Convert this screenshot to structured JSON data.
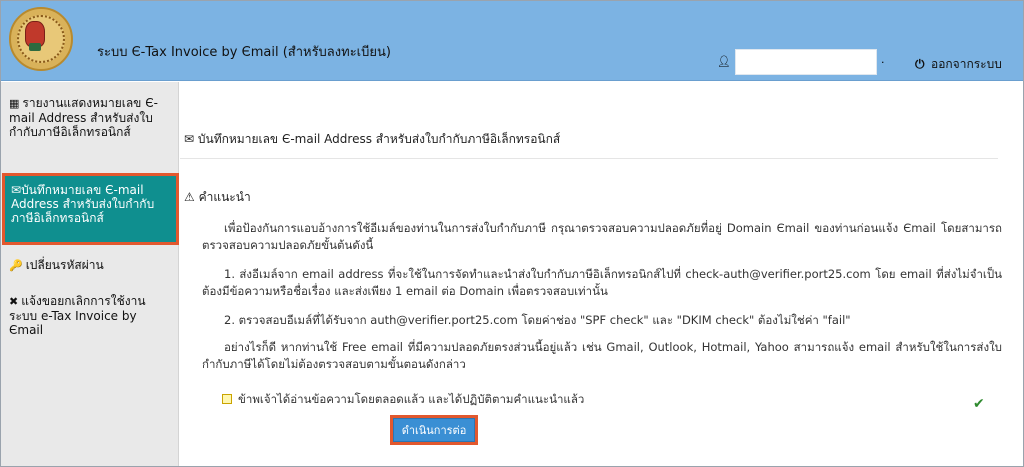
{
  "header": {
    "app_title": "ระบบ Є-Tax Invoice by Єmail (สำหรับลงทะเบียน)",
    "user_icon": "user-icon",
    "user_name": "",
    "logout_label": "ออกจากระบบ"
  },
  "sidebar": {
    "items": [
      {
        "icon": "▦",
        "label": "รายงานแสดงหมายเลข Є-mail Address สำหรับส่งใบกำกับภาษีอิเล็กทรอนิกส์"
      },
      {
        "icon": "✉",
        "label": "บันทึกหมายเลข Є-mail Address สำหรับส่งใบกำกับภาษีอิเล็กทรอนิกส์"
      },
      {
        "icon": "🔑",
        "label": "เปลี่ยนรหัสผ่าน"
      },
      {
        "icon": "✖",
        "label": "แจ้งขอยกเลิกการใช้งานระบบ e-Tax Invoice by Єmail"
      }
    ]
  },
  "main": {
    "section_icon": "✉",
    "section_title": "บันทึกหมายเลข Є-mail Address สำหรับส่งใบกำกับภาษีอิเล็กทรอนิกส์",
    "advice_icon": "⚠",
    "advice_title": "คำแนะนำ",
    "p1": "เพื่อป้องกันการแอบอ้างการใช้อีเมล์ของท่านในการส่งใบกำกับภาษี กรุณาตรวจสอบความปลอดภัยที่อยู่ Domain Єmail ของท่านก่อนแจ้ง Єmail โดยสามารถตรวจสอบความปลอดภัยขั้นต้นดังนี้",
    "p2": "1. ส่งอีเมล์จาก email address ที่จะใช้ในการจัดทำและนำส่งใบกำกับภาษีอิเล็กทรอนิกส์ไปที่ check-auth@verifier.port25.com โดย email ที่ส่งไม่จำเป็นต้องมีข้อความหรือชื่อเรื่อง และส่งเพียง 1 email ต่อ Domain เพื่อตรวจสอบเท่านั้น",
    "p3": "2. ตรวจสอบอีเมล์ที่ได้รับจาก auth@verifier.port25.com โดยค่าช่อง \"SPF check\" และ \"DKIM check\" ต้องไม่ใช่ค่า \"fail\"",
    "p4": "อย่างไรก็ดี หากท่านใช้ Free email ที่มีความปลอดภัยตรงส่วนนี้อยู่แล้ว เช่น Gmail, Outlook, Hotmail, Yahoo สามารถแจ้ง email สำหรับใช้ในการส่งใบกำกับภาษีได้โดยไม่ต้องตรวจสอบตามขั้นตอนดังกล่าว",
    "ack_label": "ข้าพเจ้าได้อ่านข้อความโดยตลอดแล้ว และได้ปฏิบัติตามคำแนะนำแล้ว",
    "ack_checked": true,
    "continue_label": "ดำเนินการต่อ"
  },
  "colors": {
    "header_bg": "#7cb3e3",
    "sidebar_active_bg": "#0f8f8f",
    "highlight_border": "#e2582e",
    "button_bg": "#3a8fd4"
  }
}
